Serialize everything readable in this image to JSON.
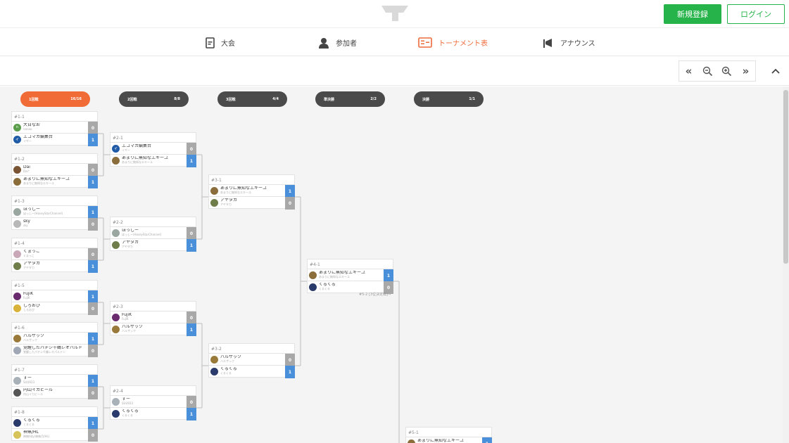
{
  "header": {
    "signup_label": "新規登録",
    "login_label": "ログイン"
  },
  "nav": [
    {
      "label": "大会",
      "icon": "document-icon",
      "active": false
    },
    {
      "label": "参加者",
      "icon": "person-icon",
      "active": false
    },
    {
      "label": "トーナメント表",
      "icon": "bracket-icon",
      "active": true
    },
    {
      "label": "アナウンス",
      "icon": "megaphone-icon",
      "active": false
    }
  ],
  "toolbar": {
    "buttons": [
      {
        "name": "collapse-all-button",
        "label": "«"
      },
      {
        "name": "zoom-out-button",
        "label": "zoom-out"
      },
      {
        "name": "zoom-in-button",
        "label": "zoom-in"
      },
      {
        "name": "expand-all-button",
        "label": "»"
      }
    ]
  },
  "rounds": [
    {
      "name": "1回戦",
      "count": "16/16",
      "active": true
    },
    {
      "name": "2回戦",
      "count": "8/8",
      "active": false
    },
    {
      "name": "3回戦",
      "count": "4/4",
      "active": false
    },
    {
      "name": "準決勝",
      "count": "2/2",
      "active": false
    },
    {
      "name": "決勝",
      "count": "1/1",
      "active": false
    }
  ],
  "matches": [
    {
      "id": "#1-1",
      "players": [
        {
          "name": "大日なお",
          "sub": "nanao",
          "score": "0",
          "win": false,
          "avatar": "#5a9e4b",
          "initial": "n"
        },
        {
          "name": "エコマカ編集台",
          "sub": "イギー",
          "score": "1",
          "win": true,
          "avatar": "#1f5aa6",
          "initial": "イ"
        }
      ]
    },
    {
      "id": "#1-2",
      "players": [
        {
          "name": "Dai",
          "sub": "Dai*",
          "score": "0",
          "win": false,
          "avatar": "#7a5535",
          "initial": ""
        },
        {
          "name": "あまりに無知なエキーユ",
          "sub": "あまりに無知なエキーユ",
          "score": "1",
          "win": true,
          "avatar": "#8a6d3b",
          "initial": ""
        }
      ]
    },
    {
      "id": "#1-3",
      "players": [
        {
          "name": "ほっしー",
          "sub": "ほっしー(HoseyStarChannel)",
          "score": "1",
          "win": true,
          "avatar": "#9aa6a0",
          "initial": ""
        },
        {
          "name": "sky",
          "sub": "sky",
          "score": "0",
          "win": false,
          "avatar": "#b8b8b8",
          "initial": ""
        }
      ]
    },
    {
      "id": "#1-4",
      "players": [
        {
          "name": "くまっこ",
          "sub": "くまっこ",
          "score": "0",
          "win": false,
          "avatar": "#c9a9b8",
          "initial": ""
        },
        {
          "name": "アヤタカ",
          "sub": "アヤタカ",
          "score": "1",
          "win": true,
          "avatar": "#6e7d4a",
          "initial": ""
        }
      ]
    },
    {
      "id": "#1-5",
      "players": [
        {
          "name": "FujiK",
          "sub": "FujiK",
          "score": "1",
          "win": true,
          "avatar": "#6a2a6e",
          "initial": ""
        },
        {
          "name": "しろおび",
          "sub": "しろおび",
          "score": "0",
          "win": false,
          "avatar": "#d9b23a",
          "initial": ""
        }
      ]
    },
    {
      "id": "#1-6",
      "players": [
        {
          "name": "バルザック",
          "sub": "バルザック",
          "score": "1",
          "win": true,
          "avatar": "#9a7a3a",
          "initial": ""
        },
        {
          "name": "覚醒したパチシ千鶴レオパルド",
          "sub": "覚醒したパチシ千鶴レオパルドン",
          "score": "0",
          "win": false,
          "avatar": "#a0a8b5",
          "initial": ""
        }
      ]
    },
    {
      "id": "#1-7",
      "players": [
        {
          "name": "すー",
          "sub": "SUU923",
          "score": "1",
          "win": true,
          "avatar": "#a8b0b8",
          "initial": ""
        },
        {
          "name": "内山イカビール",
          "sub": "内山イカビール",
          "score": "0",
          "win": false,
          "avatar": "#555555",
          "initial": ""
        }
      ]
    },
    {
      "id": "#1-8",
      "players": [
        {
          "name": "くるくる",
          "sub": "くるくる",
          "score": "1",
          "win": true,
          "avatar": "#2a3a6a",
          "initial": ""
        },
        {
          "name": "神無/HL",
          "sub": "神無tidy(神無月/HL)",
          "score": "0",
          "win": false,
          "avatar": "#d6c35a",
          "initial": ""
        }
      ]
    },
    {
      "id": "#2-1",
      "players": [
        {
          "name": "エコマカ編集台",
          "sub": "イギー",
          "score": "0",
          "win": false,
          "avatar": "#1f5aa6",
          "initial": "イ"
        },
        {
          "name": "あまりに無知なエキーユ",
          "sub": "あまりに無知なエキーユ",
          "score": "1",
          "win": true,
          "avatar": "#8a6d3b",
          "initial": ""
        }
      ]
    },
    {
      "id": "#2-2",
      "players": [
        {
          "name": "ほっしー",
          "sub": "ほっしー(HoseyStarChannel)",
          "score": "0",
          "win": false,
          "avatar": "#9aa6a0",
          "initial": ""
        },
        {
          "name": "アヤタカ",
          "sub": "アヤタカ",
          "score": "1",
          "win": true,
          "avatar": "#6e7d4a",
          "initial": ""
        }
      ]
    },
    {
      "id": "#2-3",
      "players": [
        {
          "name": "FujiK",
          "sub": "FujiK",
          "score": "0",
          "win": false,
          "avatar": "#6a2a6e",
          "initial": ""
        },
        {
          "name": "バルザック",
          "sub": "バルザック",
          "score": "1",
          "win": true,
          "avatar": "#9a7a3a",
          "initial": ""
        }
      ]
    },
    {
      "id": "#2-4",
      "players": [
        {
          "name": "すー",
          "sub": "SUU923",
          "score": "0",
          "win": false,
          "avatar": "#a8b0b8",
          "initial": ""
        },
        {
          "name": "くるくる",
          "sub": "くるくる",
          "score": "1",
          "win": true,
          "avatar": "#2a3a6a",
          "initial": ""
        }
      ]
    },
    {
      "id": "#3-1",
      "players": [
        {
          "name": "あまりに無知なエキーユ",
          "sub": "あまりに無知なエキーユ",
          "score": "1",
          "win": true,
          "avatar": "#8a6d3b",
          "initial": ""
        },
        {
          "name": "アヤタカ",
          "sub": "アヤタカ",
          "score": "0",
          "win": false,
          "avatar": "#6e7d4a",
          "initial": ""
        }
      ]
    },
    {
      "id": "#3-2",
      "players": [
        {
          "name": "バルザック",
          "sub": "バルザック",
          "score": "0",
          "win": false,
          "avatar": "#9a7a3a",
          "initial": ""
        },
        {
          "name": "くるくる",
          "sub": "くるくる",
          "score": "1",
          "win": true,
          "avatar": "#2a3a6a",
          "initial": ""
        }
      ]
    },
    {
      "id": "#4-1",
      "players": [
        {
          "name": "あまりに無知なエキーユ",
          "sub": "あまりに無知なエキーユ",
          "score": "1",
          "win": true,
          "avatar": "#8a6d3b",
          "initial": ""
        },
        {
          "name": "くるくる",
          "sub": "くるくる",
          "score": "0",
          "win": false,
          "avatar": "#2a3a6a",
          "initial": ""
        }
      ]
    },
    {
      "id": "#5-1",
      "players": [
        {
          "name": "あまりに無知なエキーユ",
          "sub": "あまりに無知なエキーユ",
          "score": "1",
          "win": true,
          "avatar": "#8a6d3b",
          "initial": ""
        }
      ]
    }
  ],
  "notes": {
    "third_place": "#5-2 [3位決定戦]→"
  },
  "colors": {
    "accent": "#f06b36",
    "brand_green": "#26b34a",
    "win_score": "#4a8fd9",
    "lose_score": "#a8a8a8"
  }
}
